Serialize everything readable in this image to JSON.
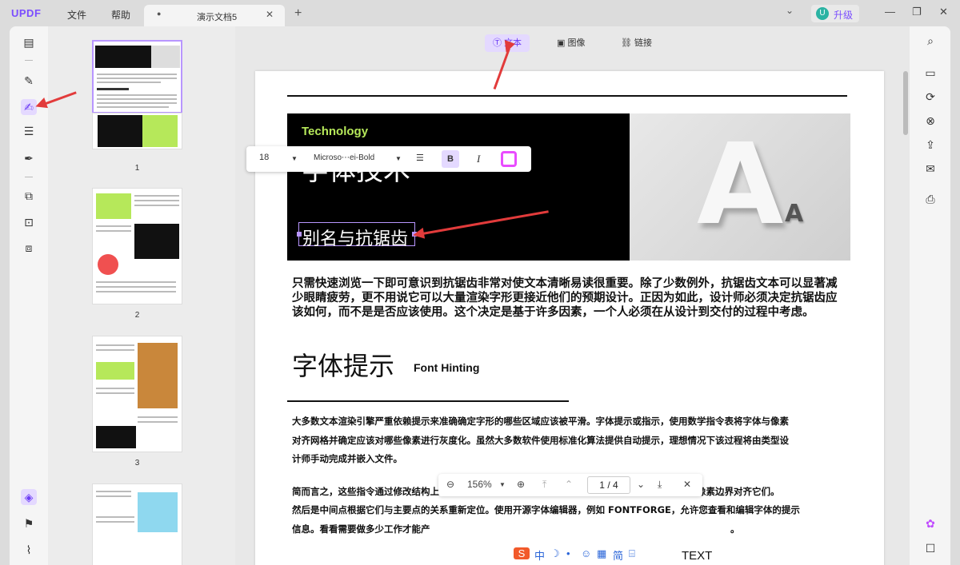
{
  "app": {
    "logo": "UPDF",
    "menu": [
      "文件",
      "帮助"
    ],
    "upgrade_label": "升级",
    "upgrade_badge": "U"
  },
  "tab": {
    "name": "演示文档5"
  },
  "toolbar": {
    "text": "文本",
    "image": "图像",
    "link": "链接"
  },
  "thumbnails": [
    {
      "page": "1"
    },
    {
      "page": "2"
    },
    {
      "page": "3"
    }
  ],
  "page": {
    "hero_label": "Technology",
    "hero_title": "字体技术",
    "edit_text": "别名与抗锯齿",
    "para1": "只需快速浏览一下即可意识到抗锯齿非常对使文本清晰易读很重要。除了少数例外，抗锯齿文本可以显著减少眼睛疲劳，更不用说它可以大量渲染字形更接近他们的预期设计。正因为如此，设计师必须决定抗锯齿应该如何，而不是是否应该使用。这个决定是基于许多因素，一个人必须在从设计到交付的过程中考虑。",
    "h2": "字体提示",
    "h2_en": "Font Hinting",
    "para2": [
      "大多数文本渲染引擎严重依赖提示来准确确定字形的哪些区域应该被平滑。字体提示或指示，使用数学指令表将字体与像素",
      "对齐网格并确定应该对哪些像素进行灰度化。虽然大多数软件使用标准化算法提供自动提示，理想情况下该过程将由类型设",
      "计师手动完成并嵌入文件。",
      "简而言之，这些指令通过修改结构上的位置来工作重要的点，例如沿样条线或在茎部发现的点，并在像素边界对齐它们。",
      "然后是中间点根据它们与主要点的关系重新定位。使用开源字体编辑器，例如 FONTFORGE，允许您查看和编辑字体的提示",
      "信息。看看需要做多少工作才能产"
    ],
    "para2_tail": "。"
  },
  "format_bar": {
    "font_size": "18",
    "font_name": "Microso⋯ei-Bold",
    "bold": "B",
    "italic": "I"
  },
  "nav": {
    "zoom": "156%",
    "page_current": "1",
    "page_sep": "/",
    "page_total": "4"
  },
  "ime": {
    "items": [
      "S",
      "中",
      "☽",
      "•",
      "☺",
      "▦",
      "简",
      "⌸"
    ]
  },
  "text_label": "TEXT"
}
